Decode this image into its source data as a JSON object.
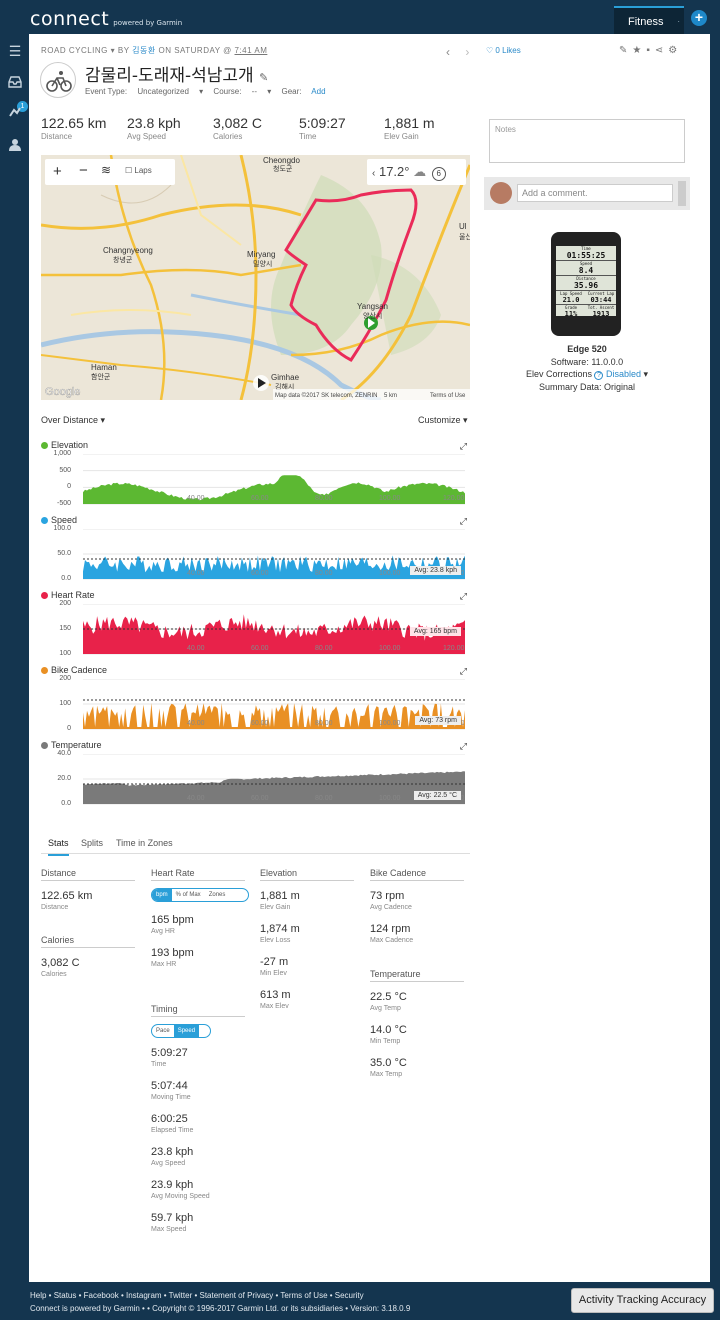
{
  "header": {
    "brand": "connect",
    "brand_sub": "powered by Garmin",
    "tab_fitness": "Fitness",
    "plus": "+"
  },
  "sidenav": {
    "badge": "1",
    "icons": [
      "menu-icon",
      "inbox-icon",
      "challenges-icon",
      "profile-icon"
    ]
  },
  "activity": {
    "type": "ROAD CYCLING",
    "by": "BY",
    "author": "김동환",
    "on": "ON SATURDAY @",
    "time": "7:41 AM",
    "title": "감물리-도래재-석남고개",
    "event_type_label": "Event Type:",
    "event_type_value": "Uncategorized",
    "course_label": "Course:",
    "course_value": "--",
    "gear_label": "Gear:",
    "gear_value": "Add",
    "likes": "0 Likes"
  },
  "summary": [
    {
      "value": "122.65 km",
      "label": "Distance"
    },
    {
      "value": "23.8 kph",
      "label": "Avg Speed"
    },
    {
      "value": "3,082 C",
      "label": "Calories"
    },
    {
      "value": "5:09:27",
      "label": "Time"
    },
    {
      "value": "1,881 m",
      "label": "Elev Gain"
    }
  ],
  "side": {
    "notes_placeholder": "Notes",
    "comment_placeholder": "Add a comment.",
    "device_name": "Edge 520",
    "software": "Software: 11.0.0.0",
    "elev_corr_label": "Elev Corrections",
    "elev_corr_value": "Disabled",
    "summary_data": "Summary Data: Original",
    "device_screen": [
      {
        "label": "Time",
        "value": "01:55:25"
      },
      {
        "label": "Speed",
        "value": "8.4"
      },
      {
        "label": "Distance",
        "value": "35.96"
      },
      {
        "label": "Lap Speed",
        "value": "21.0"
      },
      {
        "label": "Current Lap",
        "value": "03:44"
      },
      {
        "label": "Grade",
        "value": "11%"
      },
      {
        "label": "Tot. Ascent",
        "value": "1913"
      }
    ]
  },
  "map": {
    "laps_label": "Laps",
    "temp": "17.2°",
    "wind": "6",
    "attribution": "Map data ©2017 SK telecom, ZENRIN",
    "scale": "5 km",
    "terms": "Terms of Use",
    "google": "Google",
    "places": [
      {
        "name": "Cheongdo",
        "kr": "청도군"
      },
      {
        "name": "Changnyeong",
        "kr": "창녕군"
      },
      {
        "name": "Miryang",
        "kr": "밀양시"
      },
      {
        "name": "Yangsan",
        "kr": "양산시"
      },
      {
        "name": "Gimhae",
        "kr": "김해시"
      },
      {
        "name": "Haman",
        "kr": "함안군"
      },
      {
        "name": "Ul",
        "kr": "울산"
      }
    ]
  },
  "charts_header": {
    "over": "Over Distance",
    "customize": "Customize"
  },
  "charts": [
    {
      "name": "Elevation",
      "color": "#5cb832",
      "ticks": [
        "1,000",
        "500",
        "0",
        "-500"
      ],
      "avg": ""
    },
    {
      "name": "Speed",
      "color": "#2aa4e0",
      "ticks": [
        "100.0",
        "50.0",
        "0.0"
      ],
      "avg": "Avg: 23.8 kph"
    },
    {
      "name": "Heart Rate",
      "color": "#e8224a",
      "ticks": [
        "200",
        "150",
        "100"
      ],
      "avg": "Avg: 165 bpm"
    },
    {
      "name": "Bike Cadence",
      "color": "#e99024",
      "ticks": [
        "200",
        "100",
        "0"
      ],
      "avg": "Avg: 73 rpm"
    },
    {
      "name": "Temperature",
      "color": "#7a7a7a",
      "ticks": [
        "40.0",
        "20.0",
        "0.0"
      ],
      "avg": "Avg: 22.5 °C"
    }
  ],
  "chart_x_ticks": [
    "40.00",
    "60.00",
    "80.00",
    "100.00",
    "120.00"
  ],
  "tabs": [
    "Stats",
    "Splits",
    "Time in Zones"
  ],
  "stats": {
    "distance": {
      "head": "Distance",
      "value": "122.65 km",
      "label": "Distance"
    },
    "calories": {
      "head": "Calories",
      "value": "3,082 C",
      "label": "Calories"
    },
    "heart_rate": {
      "head": "Heart Rate",
      "toggle": [
        "bpm",
        "% of Max",
        "Zones"
      ],
      "items": [
        {
          "value": "165 bpm",
          "label": "Avg HR"
        },
        {
          "value": "193 bpm",
          "label": "Max HR"
        }
      ]
    },
    "timing": {
      "head": "Timing",
      "toggle": [
        "Pace",
        "Speed"
      ],
      "items": [
        {
          "value": "5:09:27",
          "label": "Time"
        },
        {
          "value": "5:07:44",
          "label": "Moving Time"
        },
        {
          "value": "6:00:25",
          "label": "Elapsed Time"
        },
        {
          "value": "23.8 kph",
          "label": "Avg Speed"
        },
        {
          "value": "23.9 kph",
          "label": "Avg Moving Speed"
        },
        {
          "value": "59.7 kph",
          "label": "Max Speed"
        }
      ]
    },
    "elevation": {
      "head": "Elevation",
      "items": [
        {
          "value": "1,881 m",
          "label": "Elev Gain"
        },
        {
          "value": "1,874 m",
          "label": "Elev Loss"
        },
        {
          "value": "-27 m",
          "label": "Min Elev"
        },
        {
          "value": "613 m",
          "label": "Max Elev"
        }
      ]
    },
    "cadence": {
      "head": "Bike Cadence",
      "items": [
        {
          "value": "73 rpm",
          "label": "Avg Cadence"
        },
        {
          "value": "124 rpm",
          "label": "Max Cadence"
        }
      ]
    },
    "temperature": {
      "head": "Temperature",
      "items": [
        {
          "value": "22.5 °C",
          "label": "Avg Temp"
        },
        {
          "value": "14.0 °C",
          "label": "Min Temp"
        },
        {
          "value": "35.0 °C",
          "label": "Max Temp"
        }
      ]
    }
  },
  "footer": {
    "links": "Help • Status • Facebook • Instagram • Twitter • Statement of Privacy • Terms of Use • Security",
    "copyright": "Connect is powered by Garmin • • Copyright © 1996-2017 Garmin Ltd. or its subsidiaries • Version: 3.18.0.9",
    "tracking_button": "Activity Tracking Accuracy"
  }
}
